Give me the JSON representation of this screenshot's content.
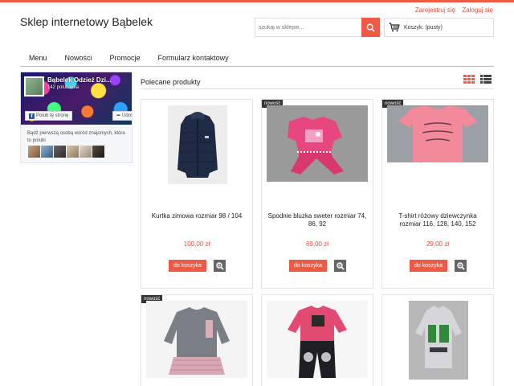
{
  "header": {
    "shop_title": "Sklep internetowy Bąbelek",
    "register_label": "Zarejestruj się",
    "login_label": "Zaloguj się",
    "search_placeholder": "szukaj w sklepie...",
    "cart_label": "Koszyk: (pusty)"
  },
  "nav": {
    "items": [
      {
        "label": "Menu"
      },
      {
        "label": "Nowości"
      },
      {
        "label": "Promocje"
      },
      {
        "label": "Formularz kontaktowy"
      }
    ]
  },
  "facebook": {
    "page_name": "Bąbelek Odzież Dzi...",
    "likes": "142 polubienia",
    "like_label": "Polub tę stronę",
    "share_label": "Udostępnij",
    "friends_text": "Bądź pierwszą osobą wśród znajomych, która to polubi"
  },
  "main": {
    "section_title": "Polecane produkty",
    "add_to_cart_label": "do koszyka",
    "new_badge": "nowość",
    "products": [
      {
        "name": "Kurtka zimowa rozmiar 98 / 104",
        "price": "100,00 zł",
        "is_new": false
      },
      {
        "name": "Spodnie bluzka sweter rozmiar 74, 86, 92",
        "price": "69,00 zł",
        "is_new": true
      },
      {
        "name": "T-shirt różowy dziewczynka rozmiar 116, 128, 140, 152",
        "price": "29,00 zł",
        "is_new": true
      },
      {
        "name": "",
        "price": "",
        "is_new": true
      },
      {
        "name": "",
        "price": "",
        "is_new": false
      },
      {
        "name": "",
        "price": "",
        "is_new": false
      }
    ]
  },
  "colors": {
    "accent": "#ee5a44",
    "price": "#e74c3c",
    "facebook": "#3b5998"
  }
}
